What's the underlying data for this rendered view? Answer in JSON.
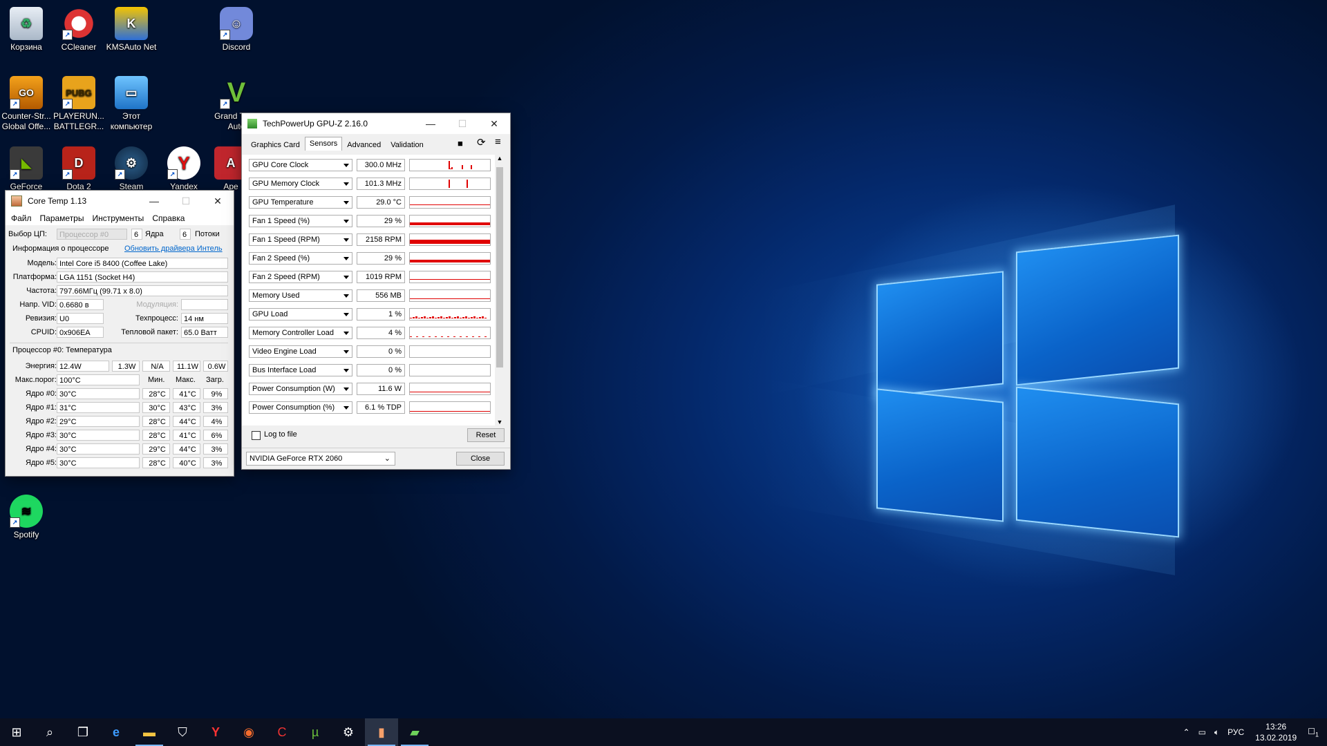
{
  "desktop": {
    "icons": [
      {
        "label": "Корзина",
        "icon": "recycle-bin-icon"
      },
      {
        "label": "CCleaner",
        "icon": "ccleaner-icon"
      },
      {
        "label": "KMSAuto Net",
        "icon": "kmsauto-icon"
      },
      {
        "label": "Discord",
        "icon": "discord-icon"
      },
      {
        "label": "Counter-Str... Global Offe...",
        "icon": "csgo-icon"
      },
      {
        "label": "PLAYERUN... BATTLEGR...",
        "icon": "pubg-icon"
      },
      {
        "label": "Этот компьютер",
        "icon": "this-pc-icon"
      },
      {
        "label": "Grand Theft Auto",
        "icon": "gta-icon"
      },
      {
        "label": "GeForce",
        "icon": "geforce-icon"
      },
      {
        "label": "Dota 2",
        "icon": "dota2-icon"
      },
      {
        "label": "Steam",
        "icon": "steam-icon"
      },
      {
        "label": "Yandex",
        "icon": "yandex-icon"
      },
      {
        "label": "Ape",
        "icon": "apex-icon"
      },
      {
        "label": "Spotify",
        "icon": "spotify-icon"
      }
    ]
  },
  "coretemp": {
    "title": "Core Temp 1.13",
    "menu": [
      "Файл",
      "Параметры",
      "Инструменты",
      "Справка"
    ],
    "cpu_select_label": "Выбор ЦП:",
    "cpu_select_value": "Процессор #0",
    "cores_count": "6",
    "cores_label": "Ядра",
    "threads_count": "6",
    "threads_label": "Потоки",
    "info_label": "Информация о процессоре",
    "update_link": "Обновить драйвера Интель",
    "model_label": "Модель:",
    "model": "Intel Core i5 8400 (Coffee Lake)",
    "platform_label": "Платформа:",
    "platform": "LGA 1151 (Socket H4)",
    "freq_label": "Частота:",
    "freq": "797.66МГц (99.71 x 8.0)",
    "vid_label": "Напр. VID:",
    "vid": "0.6680 в",
    "modulation_label": "Модуляция:",
    "revision_label": "Ревизия:",
    "revision": "U0",
    "process_label": "Техпроцесс:",
    "process": "14 нм",
    "cpuid_label": "CPUID:",
    "cpuid": "0x906EA",
    "tdp_label": "Тепловой пакет:",
    "tdp": "65.0 Ватт",
    "temp_section": "Процессор #0: Температура",
    "power_label": "Энергия:",
    "power": [
      "12.4W",
      "1.3W",
      "N/A",
      "11.1W",
      "0.6W"
    ],
    "tjmax_label": "Макс.порог:",
    "tjmax": "100°C",
    "min_header": "Мин.",
    "max_header": "Макс.",
    "load_header": "Загр.",
    "cores": [
      {
        "label": "Ядро #0:",
        "temp": "30°C",
        "min": "28°C",
        "max": "41°C",
        "load": "9%"
      },
      {
        "label": "Ядро #1:",
        "temp": "31°C",
        "min": "30°C",
        "max": "43°C",
        "load": "3%"
      },
      {
        "label": "Ядро #2:",
        "temp": "29°C",
        "min": "28°C",
        "max": "44°C",
        "load": "4%"
      },
      {
        "label": "Ядро #3:",
        "temp": "30°C",
        "min": "28°C",
        "max": "41°C",
        "load": "6%"
      },
      {
        "label": "Ядро #4:",
        "temp": "30°C",
        "min": "29°C",
        "max": "44°C",
        "load": "3%"
      },
      {
        "label": "Ядро #5:",
        "temp": "30°C",
        "min": "28°C",
        "max": "40°C",
        "load": "3%"
      }
    ]
  },
  "gpuz": {
    "title": "TechPowerUp GPU-Z 2.16.0",
    "tabs": [
      "Graphics Card",
      "Sensors",
      "Advanced",
      "Validation"
    ],
    "active_tab": "Sensors",
    "sensors": [
      {
        "name": "GPU Core Clock",
        "value": "300.0 MHz",
        "graph": "spikes",
        "level": 0
      },
      {
        "name": "GPU Memory Clock",
        "value": "101.3 MHz",
        "graph": "spikes2",
        "level": 0
      },
      {
        "name": "GPU Temperature",
        "value": "29.0 °C",
        "graph": "line",
        "level": 0.29
      },
      {
        "name": "Fan 1 Speed (%)",
        "value": "29 %",
        "graph": "bar",
        "level": 0.29
      },
      {
        "name": "Fan 1 Speed (RPM)",
        "value": "2158 RPM",
        "graph": "bar",
        "level": 0.45
      },
      {
        "name": "Fan 2 Speed (%)",
        "value": "29 %",
        "graph": "bar",
        "level": 0.29
      },
      {
        "name": "Fan 2 Speed (RPM)",
        "value": "1019 RPM",
        "graph": "line",
        "level": 0.2
      },
      {
        "name": "Memory Used",
        "value": "556 MB",
        "graph": "line",
        "level": 0.1
      },
      {
        "name": "GPU Load",
        "value": "1 %",
        "graph": "noise",
        "level": 0.01
      },
      {
        "name": "Memory Controller Load",
        "value": "4 %",
        "graph": "noise2",
        "level": 0.04
      },
      {
        "name": "Video Engine Load",
        "value": "0 %",
        "graph": "none",
        "level": 0
      },
      {
        "name": "Bus Interface Load",
        "value": "0 %",
        "graph": "none",
        "level": 0
      },
      {
        "name": "Power Consumption (W)",
        "value": "11.6 W",
        "graph": "line",
        "level": 0.1
      },
      {
        "name": "Power Consumption (%)",
        "value": "6.1 % TDP",
        "graph": "line",
        "level": 0.06
      }
    ],
    "log_label": "Log to file",
    "reset_label": "Reset",
    "gpu_select": "NVIDIA GeForce RTX 2060",
    "close_label": "Close"
  },
  "taskbar": {
    "icons": [
      "start-icon",
      "search-icon",
      "task-view-icon",
      "edge-icon",
      "explorer-icon",
      "store-icon",
      "yandex-icon",
      "origin-icon",
      "ccleaner-icon",
      "utorrent-icon",
      "steam-icon",
      "coretemp-icon",
      "gpuz-icon"
    ],
    "lang": "РУС",
    "time": "13:26",
    "date": "13.02.2019",
    "notification_count": "1"
  },
  "colors": {
    "graph": "#e00000",
    "accent": "#0078d7"
  }
}
